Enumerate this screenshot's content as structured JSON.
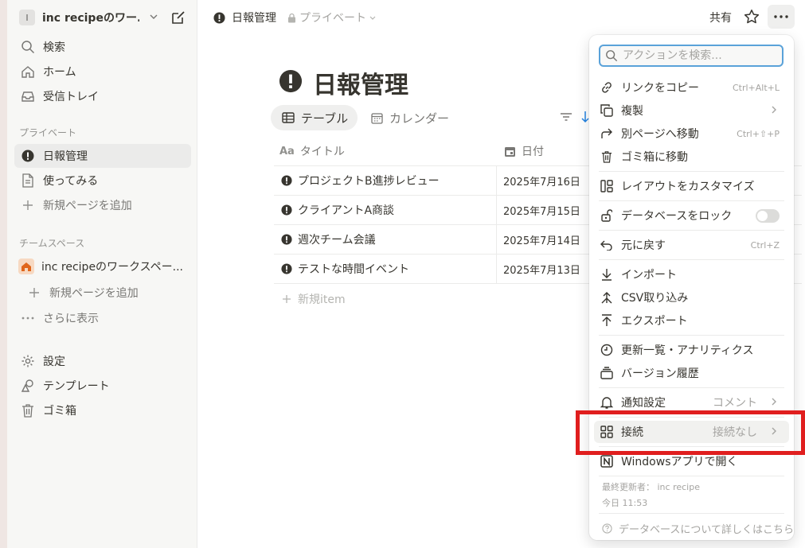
{
  "sidebar": {
    "workspace": {
      "avatar": "I",
      "name": "inc recipeのワー..."
    },
    "top_items": [
      {
        "label": "検索",
        "icon": "search-icon"
      },
      {
        "label": "ホーム",
        "icon": "home-icon"
      },
      {
        "label": "受信トレイ",
        "icon": "inbox-icon"
      }
    ],
    "private_heading": "プライベート",
    "private_items": [
      {
        "label": "日報管理",
        "icon": "alert-circle-icon",
        "active": true
      },
      {
        "label": "使ってみる",
        "icon": "page-icon"
      },
      {
        "label": "新規ページを追加",
        "icon": "plus-icon"
      }
    ],
    "team_heading": "チームスペース",
    "team_items": [
      {
        "label": "inc recipeのワークスペー...",
        "icon": "home-badge-icon"
      },
      {
        "label": "新規ページを追加",
        "icon": "plus-icon"
      },
      {
        "label": "さらに表示",
        "icon": "more-horizontal-icon"
      }
    ],
    "bottom_items": [
      {
        "label": "設定",
        "icon": "gear-icon"
      },
      {
        "label": "テンプレート",
        "icon": "template-icon"
      },
      {
        "label": "ゴミ箱",
        "icon": "trash-icon"
      }
    ]
  },
  "topbar": {
    "title": "日報管理",
    "privacy": "プライベート",
    "share": "共有"
  },
  "page": {
    "title": "日報管理",
    "views": [
      {
        "label": "テーブル",
        "icon": "table-icon",
        "active": true
      },
      {
        "label": "カレンダー",
        "icon": "calendar-icon",
        "active": false
      }
    ],
    "columns": [
      "タイトル",
      "日付"
    ],
    "rows": [
      {
        "title": "プロジェクトB進捗レビュー",
        "date": "2025年7月16日"
      },
      {
        "title": "クライアントA商談",
        "date": "2025年7月15日"
      },
      {
        "title": "週次チーム会議",
        "date": "2025年7月14日"
      },
      {
        "title": "テストな時間イベント",
        "date": "2025年7月13日"
      }
    ],
    "new_item": "新規item"
  },
  "menu": {
    "search_placeholder": "アクションを検索...",
    "items": {
      "copy_link": {
        "label": "リンクをコピー",
        "shortcut": "Ctrl+Alt+L"
      },
      "duplicate": {
        "label": "複製"
      },
      "move": {
        "label": "別ページへ移動",
        "shortcut": "Ctrl+⇧+P"
      },
      "trash": {
        "label": "ゴミ箱に移動"
      },
      "layout": {
        "label": "レイアウトをカスタマイズ"
      },
      "lock": {
        "label": "データベースをロック"
      },
      "undo": {
        "label": "元に戻す",
        "shortcut": "Ctrl+Z"
      },
      "import": {
        "label": "インポート"
      },
      "csv": {
        "label": "CSV取り込み"
      },
      "export": {
        "label": "エクスポート"
      },
      "updates": {
        "label": "更新一覧・アナリティクス"
      },
      "versions": {
        "label": "バージョン履歴"
      },
      "notify": {
        "label": "通知設定",
        "value": "コメント"
      },
      "connect": {
        "label": "接続",
        "value": "接続なし"
      },
      "open_app": {
        "label": "Windowsアプリで開く"
      }
    },
    "last_edited": "最終更新者： inc recipe",
    "last_edited_time": "今日 11:53",
    "learn_more": "データベースについて詳しくはこちら"
  },
  "colors": {
    "highlight_box": "#e01e1e",
    "accent_blue": "#2383e2",
    "sidebar_bg": "#f7f7f5"
  }
}
